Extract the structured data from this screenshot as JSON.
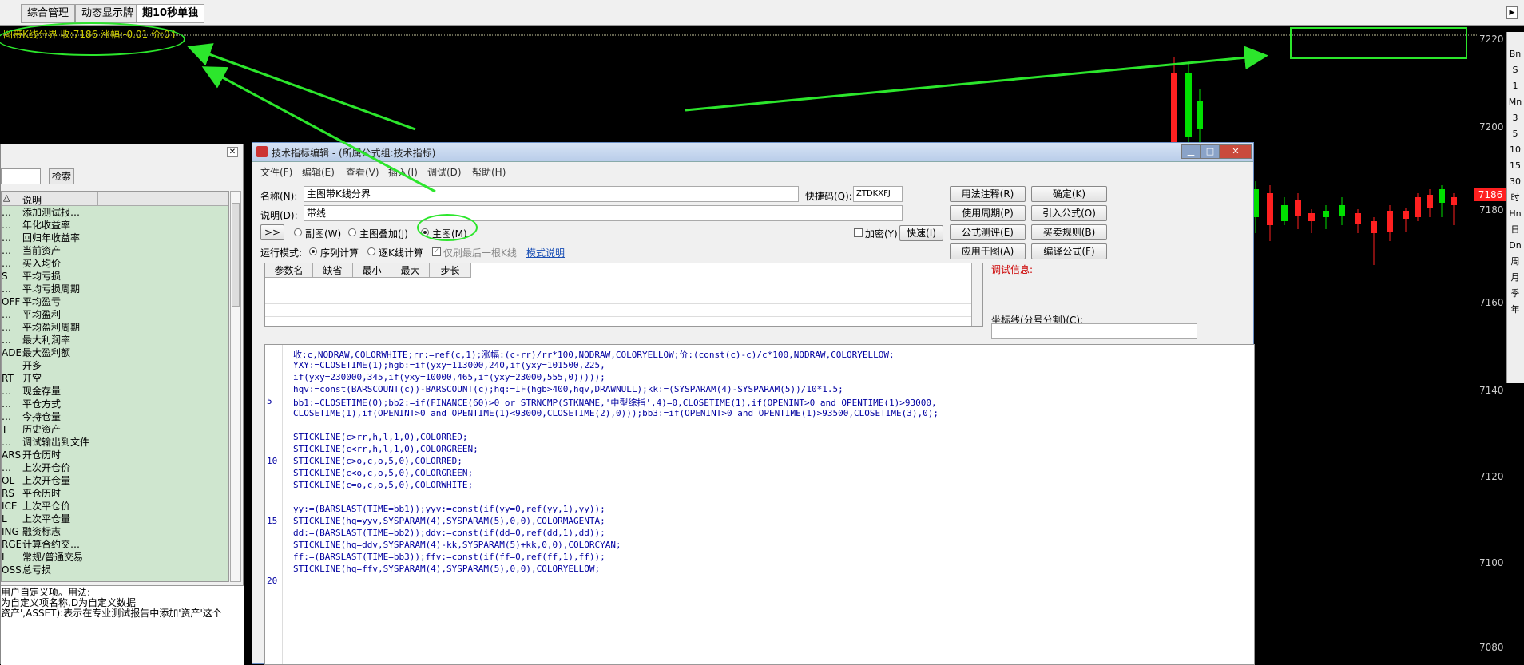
{
  "tabs": [
    {
      "label": "综合管理"
    },
    {
      "label": "动态显示牌"
    },
    {
      "label": "期10秒单独"
    }
  ],
  "chart": {
    "info_line": "图带K线分界 收:7186 涨幅:-0.01 价:0↑",
    "y_ticks": [
      "7220",
      "7200",
      "7180",
      "7160",
      "7140",
      "7120",
      "7100",
      "7080"
    ],
    "price_tag": "7186",
    "up_color": "#ff2020",
    "down_color": "#00e000"
  },
  "side_toolbar": [
    "Bn",
    "S",
    "1",
    "Mn",
    "3",
    "5",
    "10",
    "15",
    "30",
    "时",
    "Hn",
    "日",
    "Dn",
    "周",
    "月",
    "季",
    "年"
  ],
  "left_panel": {
    "search_button": "检索",
    "column_header": "说明",
    "rows": [
      {
        "c1": "…",
        "c2": "添加测试报…"
      },
      {
        "c1": "…",
        "c2": "年化收益率"
      },
      {
        "c1": "…",
        "c2": "回归年收益率"
      },
      {
        "c1": "…",
        "c2": "当前资产"
      },
      {
        "c1": "…",
        "c2": "买入均价"
      },
      {
        "c1": "S",
        "c2": "平均亏损"
      },
      {
        "c1": "…",
        "c2": "平均亏损周期"
      },
      {
        "c1": "OFF",
        "c2": "平均盈亏"
      },
      {
        "c1": "…",
        "c2": "平均盈利"
      },
      {
        "c1": "…",
        "c2": "平均盈利周期"
      },
      {
        "c1": "…",
        "c2": "最大利润率"
      },
      {
        "c1": "ADE",
        "c2": "最大盈利额"
      },
      {
        "c1": "",
        "c2": "开多"
      },
      {
        "c1": "RT",
        "c2": "开空"
      },
      {
        "c1": "…",
        "c2": "现金存量"
      },
      {
        "c1": "…",
        "c2": "平仓方式"
      },
      {
        "c1": "…",
        "c2": "今持仓量"
      },
      {
        "c1": "T",
        "c2": "历史资产"
      },
      {
        "c1": "…",
        "c2": "调试输出到文件"
      },
      {
        "c1": "ARS",
        "c2": "开仓历时"
      },
      {
        "c1": "…",
        "c2": "上次开仓价"
      },
      {
        "c1": "OL",
        "c2": "上次开仓量"
      },
      {
        "c1": "RS",
        "c2": "平仓历时"
      },
      {
        "c1": "ICE",
        "c2": "上次平仓价"
      },
      {
        "c1": "L",
        "c2": "上次平仓量"
      },
      {
        "c1": "ING",
        "c2": "融资标志"
      },
      {
        "c1": "RGE",
        "c2": "计算合约交…"
      },
      {
        "c1": "L",
        "c2": "常规/普通交易"
      },
      {
        "c1": "OSS",
        "c2": "总亏损"
      }
    ],
    "desc_lines": [
      "用户自定义项。用法:",
      "为自定义项名称,D为自定义数据",
      "资产',ASSET):表示在专业测试报告中添加'资产'这个"
    ]
  },
  "dialog": {
    "title": "技术指标编辑 - (所属公式组:技术指标)",
    "menus": [
      "文件(F)",
      "编辑(E)",
      "查看(V)",
      "插入(I)",
      "调试(D)",
      "帮助(H)"
    ],
    "name_label": "名称(N):",
    "name_value": "主图带K线分界",
    "desc_label": "说明(D):",
    "desc_value": "带线",
    "shortcut_label": "快捷码(Q):",
    "shortcut_value": "ZTDKXFJ",
    "expand_btn": ">>",
    "radio_sub": "副图(W)",
    "radio_overlay": "主图叠加(J)",
    "radio_main": "主图(M)",
    "encrypt_label": "加密(Y)",
    "speed_btn": "快速(I)",
    "run_mode_label": "运行模式:",
    "run_seq": "序列计算",
    "run_bar": "逐K线计算",
    "refresh_last": "仅刷最后一根K线",
    "mode_help": "模式说明",
    "buttons": {
      "usage": "用法注释(R)",
      "ok": "确定(K)",
      "period": "使用周期(P)",
      "import": "引入公式(O)",
      "test": "公式测评(E)",
      "rules": "买卖规则(B)",
      "apply": "应用于图(A)",
      "compile": "编译公式(F)"
    },
    "debug_label": "调试信息:",
    "axis_label": "坐标线(分号分割)(C):",
    "param_headers": [
      "参数名",
      "缺省",
      "最小",
      "最大",
      "步长"
    ],
    "code_lines": [
      {
        "n": "",
        "t": "收:c,NODRAW,COLORWHITE;rr:=ref(c,1);涨幅:(c-rr)/rr*100,NODRAW,COLORYELLOW;价:(const(c)-c)/c*100,NODRAW,COLORYELLOW;"
      },
      {
        "n": "",
        "t": "YXY:=CLOSETIME(1);hgb:=if(yxy=113000,240,if(yxy=101500,225,"
      },
      {
        "n": "",
        "t": "if(yxy=230000,345,if(yxy=10000,465,if(yxy=23000,555,0)))));"
      },
      {
        "n": "",
        "t": "hqv:=const(BARSCOUNT(c))-BARSCOUNT(c);hq:=IF(hgb>400,hqv,DRAWNULL);kk:=(SYSPARAM(4)-SYSPARAM(5))/10*1.5;"
      },
      {
        "n": "5",
        "t": "bb1:=CLOSETIME(0);bb2:=if(FINANCE(60)>0 or STRNCMP(STKNAME,'中型综指',4)=0,CLOSETIME(1),if(OPENINT>0 and OPENTIME(1)>93000,"
      },
      {
        "n": "",
        "t": "CLOSETIME(1),if(OPENINT>0 and OPENTIME(1)<93000,CLOSETIME(2),0)));bb3:=if(OPENINT>0 and OPENTIME(1)>93500,CLOSETIME(3),0);"
      },
      {
        "n": "",
        "t": ""
      },
      {
        "n": "",
        "t": "STICKLINE(c>rr,h,l,1,0),COLORRED;"
      },
      {
        "n": "",
        "t": "STICKLINE(c<rr,h,l,1,0),COLORGREEN;"
      },
      {
        "n": "10",
        "t": "STICKLINE(c>o,c,o,5,0),COLORRED;"
      },
      {
        "n": "",
        "t": "STICKLINE(c<o,c,o,5,0),COLORGREEN;"
      },
      {
        "n": "",
        "t": "STICKLINE(c=o,c,o,5,0),COLORWHITE;"
      },
      {
        "n": "",
        "t": ""
      },
      {
        "n": "",
        "t": "yy:=(BARSLAST(TIME=bb1));yyv:=const(if(yy=0,ref(yy,1),yy));"
      },
      {
        "n": "15",
        "t": "STICKLINE(hq=yyv,SYSPARAM(4),SYSPARAM(5),0,0),COLORMAGENTA;"
      },
      {
        "n": "",
        "t": "dd:=(BARSLAST(TIME=bb2));ddv:=const(if(dd=0,ref(dd,1),dd));"
      },
      {
        "n": "",
        "t": "STICKLINE(hq=ddv,SYSPARAM(4)-kk,SYSPARAM(5)+kk,0,0),COLORCYAN;"
      },
      {
        "n": "",
        "t": "ff:=(BARSLAST(TIME=bb3));ffv:=const(if(ff=0,ref(ff,1),ff));"
      },
      {
        "n": "",
        "t": "STICKLINE(hq=ffv,SYSPARAM(4),SYSPARAM(5),0,0),COLORYELLOW;"
      },
      {
        "n": "20",
        "t": ""
      }
    ]
  }
}
